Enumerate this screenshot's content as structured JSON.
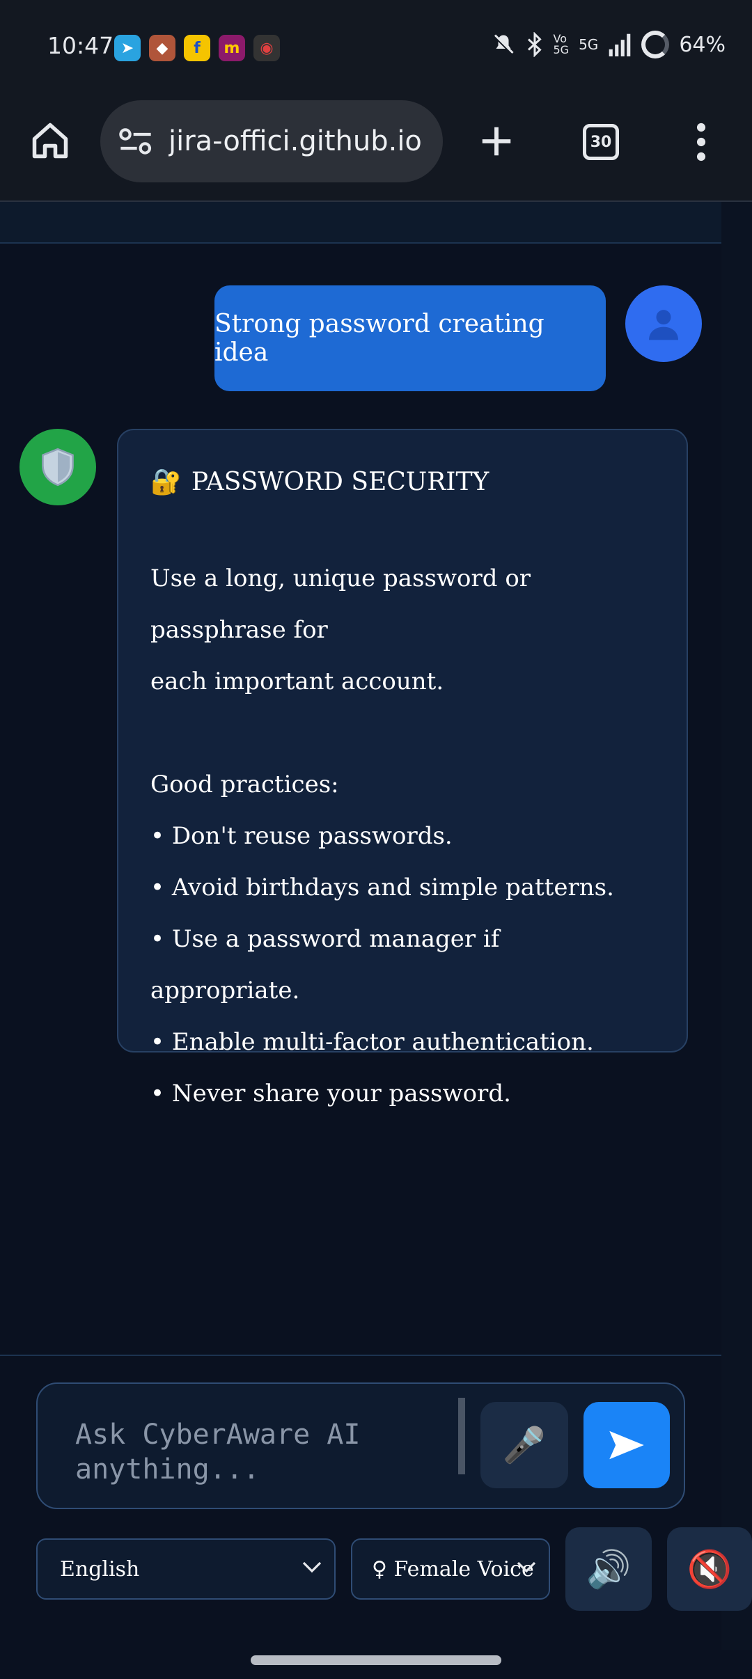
{
  "status": {
    "time": "10:47",
    "network": "5G",
    "battery": "64%",
    "apps": [
      {
        "name": "telegram-icon",
        "glyph": "➤",
        "color": "#2aa3e0"
      },
      {
        "name": "game-icon",
        "glyph": "◆",
        "color": "#b0553a"
      },
      {
        "name": "flipkart-icon",
        "glyph": "f",
        "color": "#f5c400"
      },
      {
        "name": "meesho-icon",
        "glyph": "m",
        "color": "#8c1a6a"
      },
      {
        "name": "app-icon",
        "glyph": "◉",
        "color": "#3a3a3a"
      }
    ]
  },
  "browser": {
    "url": "jira-offici.github.io",
    "tab_count": "30"
  },
  "chat": {
    "user_message": "Strong password creating idea",
    "bot": {
      "title_emoji": "🔐",
      "title": "PASSWORD SECURITY",
      "intro_line1": "Use a long, unique password or passphrase for",
      "intro_line2": "each important account.",
      "practices_heading": "Good practices:",
      "bullets": [
        "• Don't reuse passwords.",
        "• Avoid birthdays and simple patterns.",
        "• Use a password manager if appropriate.",
        "• Enable multi-factor authentication.",
        "• Never share your password."
      ]
    }
  },
  "input": {
    "placeholder": "Ask CyberAware AI anything..."
  },
  "controls": {
    "language": "English",
    "voice": "♀ Female Voice"
  },
  "colors": {
    "user_bubble": "#1e6ad4",
    "bot_bubble": "#12223c",
    "send_button": "#1a84f7",
    "bot_avatar": "#22a447"
  }
}
